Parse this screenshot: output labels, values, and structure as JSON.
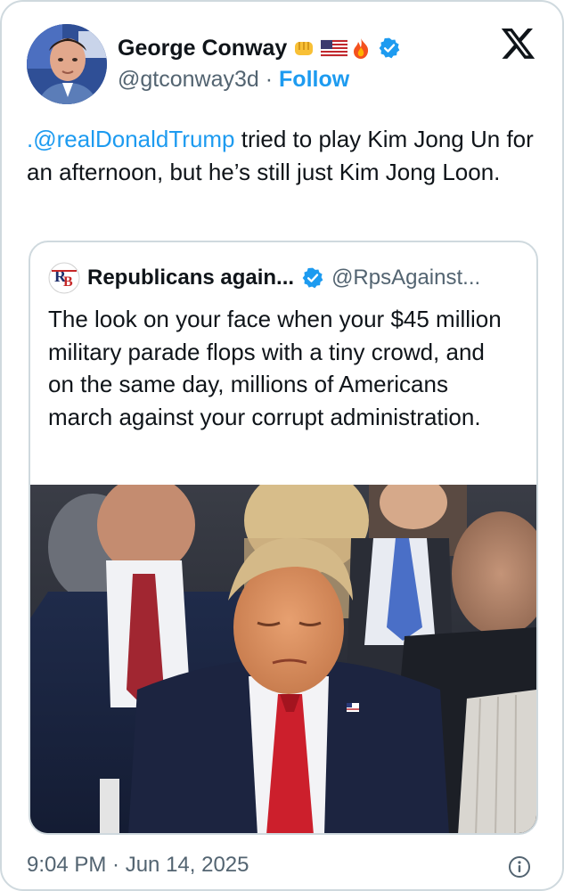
{
  "author": {
    "name": "George Conway",
    "handle": "@gtconway3d",
    "separator": " · ",
    "follow_label": "Follow",
    "verified_color": "#1d9bf0",
    "name_emojis": [
      "oncoming-fist-emoji",
      "us-flag-emoji",
      "fire-emoji"
    ]
  },
  "tweet": {
    "mention": ".@realDonaldTrump",
    "text": " tried to play Kim Jong Un for an afternoon, but he’s still just Kim Jong Loon."
  },
  "quoted": {
    "name": "Republicans again...",
    "handle": "@RpsAgainst...",
    "text": "The look on your face when your $45 million military parade flops with a tiny crowd, and on the same day, millions of Americans march against your corrupt administration.",
    "image_description_icon": "photo-of-seated-crowd"
  },
  "meta": {
    "timestamp": "9:04 PM · Jun 14, 2025",
    "info_icon": "info-icon"
  },
  "colors": {
    "link": "#1d9bf0",
    "text": "#0f1419",
    "muted": "#536471",
    "border": "#cfd9de"
  }
}
